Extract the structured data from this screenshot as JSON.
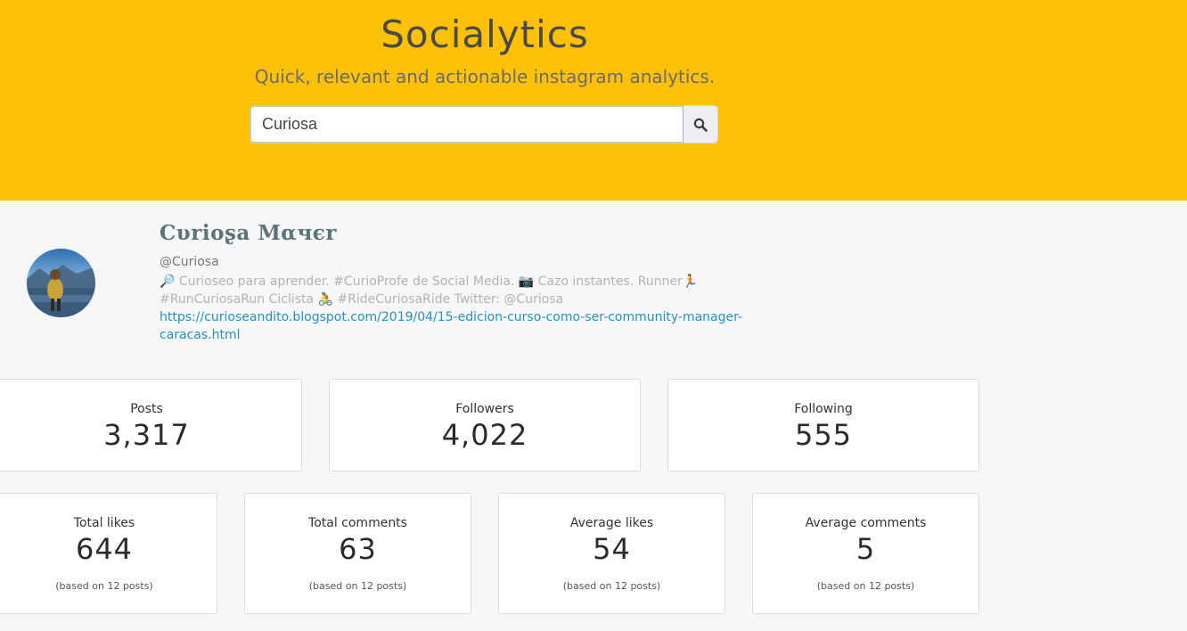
{
  "header": {
    "title": "Socialytics",
    "subtitle": "Quick, relevant and actionable instagram analytics.",
    "bg_color": "#ffc107"
  },
  "search": {
    "value": "Curiosa",
    "button_icon": "search-icon"
  },
  "profile": {
    "name": "Curiosa Mayer",
    "name_display": "Cυrioʂa Mαчєr",
    "handle": "@Curiosa",
    "bio_line1": "🔎 Curioseo para aprender. #CurioProfe de Social Media. 📷 Cazo instantes. Runner🏃",
    "bio_line2": "#RunCuriosaRun Ciclista 🚴 #RideCuriosaRide Twitter: @Curiosa",
    "link": "https://curioseandito.blogspot.com/2019/04/15-edicion-curso-como-ser-community-manager-caracas.html"
  },
  "stats_row1": [
    {
      "label": "Posts",
      "value": "3,317"
    },
    {
      "label": "Followers",
      "value": "4,022"
    },
    {
      "label": "Following",
      "value": "555"
    }
  ],
  "stats_row2": [
    {
      "label": "Total likes",
      "value": "644",
      "note": "(based on 12 posts)"
    },
    {
      "label": "Total comments",
      "value": "63",
      "note": "(based on 12 posts)"
    },
    {
      "label": "Average likes",
      "value": "54",
      "note": "(based on 12 posts)"
    },
    {
      "label": "Average comments",
      "value": "5",
      "note": "(based on 12 posts)"
    }
  ]
}
